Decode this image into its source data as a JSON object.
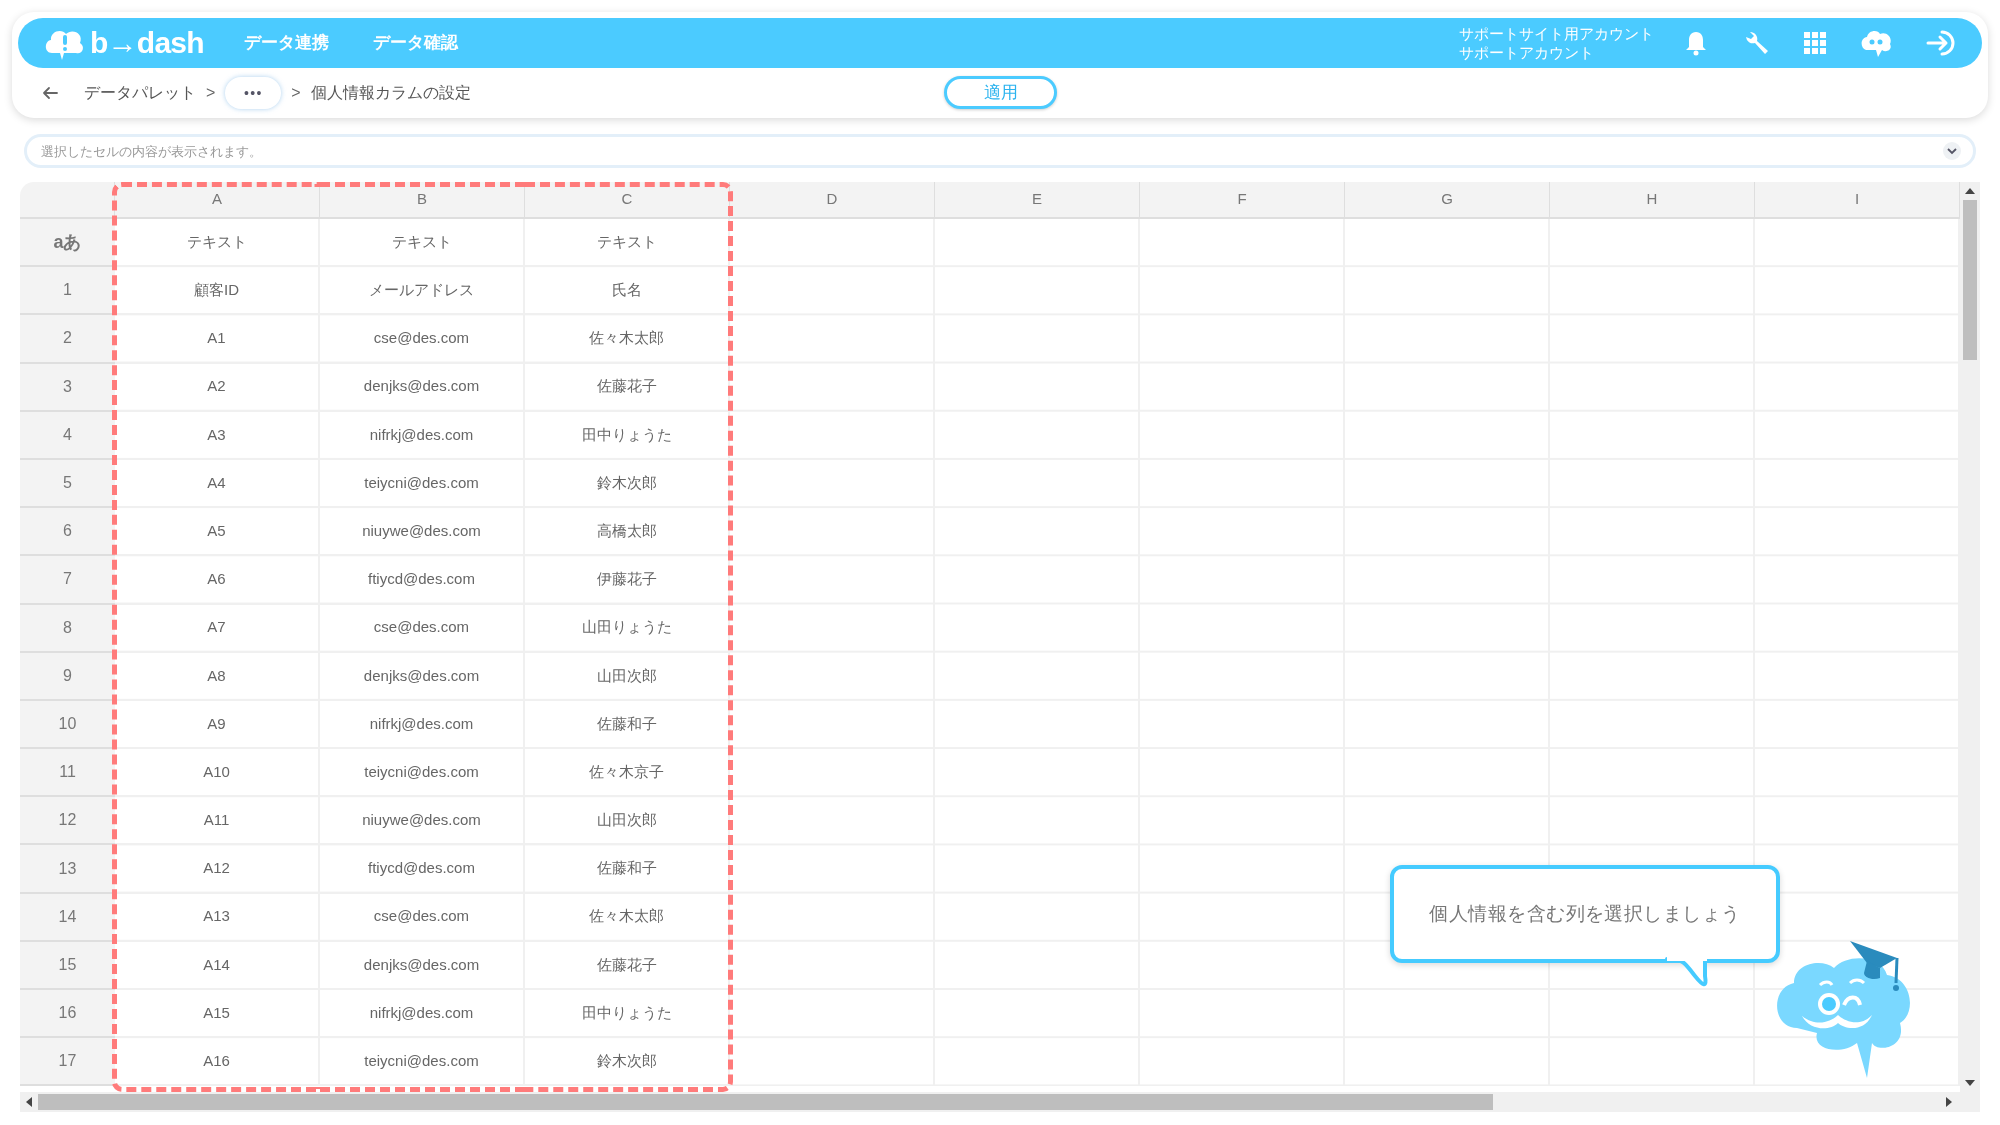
{
  "header": {
    "logo": "b→dash",
    "nav": [
      "データ連携",
      "データ確認"
    ],
    "account": [
      "サポートサイト用アカウント",
      "サポートアカウント"
    ]
  },
  "breadcrumb": {
    "items": [
      "データパレット",
      ">",
      "•••",
      ">",
      "個人情報カラムの設定"
    ]
  },
  "apply_button": "適用",
  "cell_content_bar": {
    "placeholder": "選択したセルの内容が表示されます。"
  },
  "sheet": {
    "corner": "aあ",
    "columns": [
      {
        "label": "A",
        "type": "テキスト",
        "selected": true
      },
      {
        "label": "B",
        "type": "テキスト",
        "selected": true
      },
      {
        "label": "C",
        "type": "テキスト",
        "selected": true
      },
      {
        "label": "D",
        "selected": false
      },
      {
        "label": "E",
        "selected": false
      },
      {
        "label": "F",
        "selected": false
      },
      {
        "label": "G",
        "selected": false
      },
      {
        "label": "H",
        "selected": false
      },
      {
        "label": "I",
        "selected": false
      }
    ],
    "rows": [
      {
        "number": "1",
        "cells": [
          "顧客ID",
          "メールアドレス",
          "氏名"
        ]
      },
      {
        "number": "2",
        "cells": [
          "A1",
          "cse@des.com",
          "佐々木太郎"
        ]
      },
      {
        "number": "3",
        "cells": [
          "A2",
          "denjks@des.com",
          "佐藤花子"
        ]
      },
      {
        "number": "4",
        "cells": [
          "A3",
          "nifrkj@des.com",
          "田中りょうた"
        ]
      },
      {
        "number": "5",
        "cells": [
          "A4",
          "teiycni@des.com",
          "鈴木次郎"
        ]
      },
      {
        "number": "6",
        "cells": [
          "A5",
          "niuywe@des.com",
          "高橋太郎"
        ]
      },
      {
        "number": "7",
        "cells": [
          "A6",
          "ftiycd@des.com",
          "伊藤花子"
        ]
      },
      {
        "number": "8",
        "cells": [
          "A7",
          "cse@des.com",
          "山田りょうた"
        ]
      },
      {
        "number": "9",
        "cells": [
          "A8",
          "denjks@des.com",
          "山田次郎"
        ]
      },
      {
        "number": "10",
        "cells": [
          "A9",
          "nifrkj@des.com",
          "佐藤和子"
        ]
      },
      {
        "number": "11",
        "cells": [
          "A10",
          "teiycni@des.com",
          "佐々木京子"
        ]
      },
      {
        "number": "12",
        "cells": [
          "A11",
          "niuywe@des.com",
          "山田次郎"
        ]
      },
      {
        "number": "13",
        "cells": [
          "A12",
          "ftiycd@des.com",
          "佐藤和子"
        ]
      },
      {
        "number": "14",
        "cells": [
          "A13",
          "cse@des.com",
          "佐々木太郎"
        ]
      },
      {
        "number": "15",
        "cells": [
          "A14",
          "denjks@des.com",
          "佐藤花子"
        ]
      },
      {
        "number": "16",
        "cells": [
          "A15",
          "nifrkj@des.com",
          "田中りょうた"
        ]
      },
      {
        "number": "17",
        "cells": [
          "A16",
          "teiycni@des.com",
          "鈴木次郎"
        ]
      }
    ]
  },
  "hint_bubble": "個人情報を含む列を選択しましょう"
}
